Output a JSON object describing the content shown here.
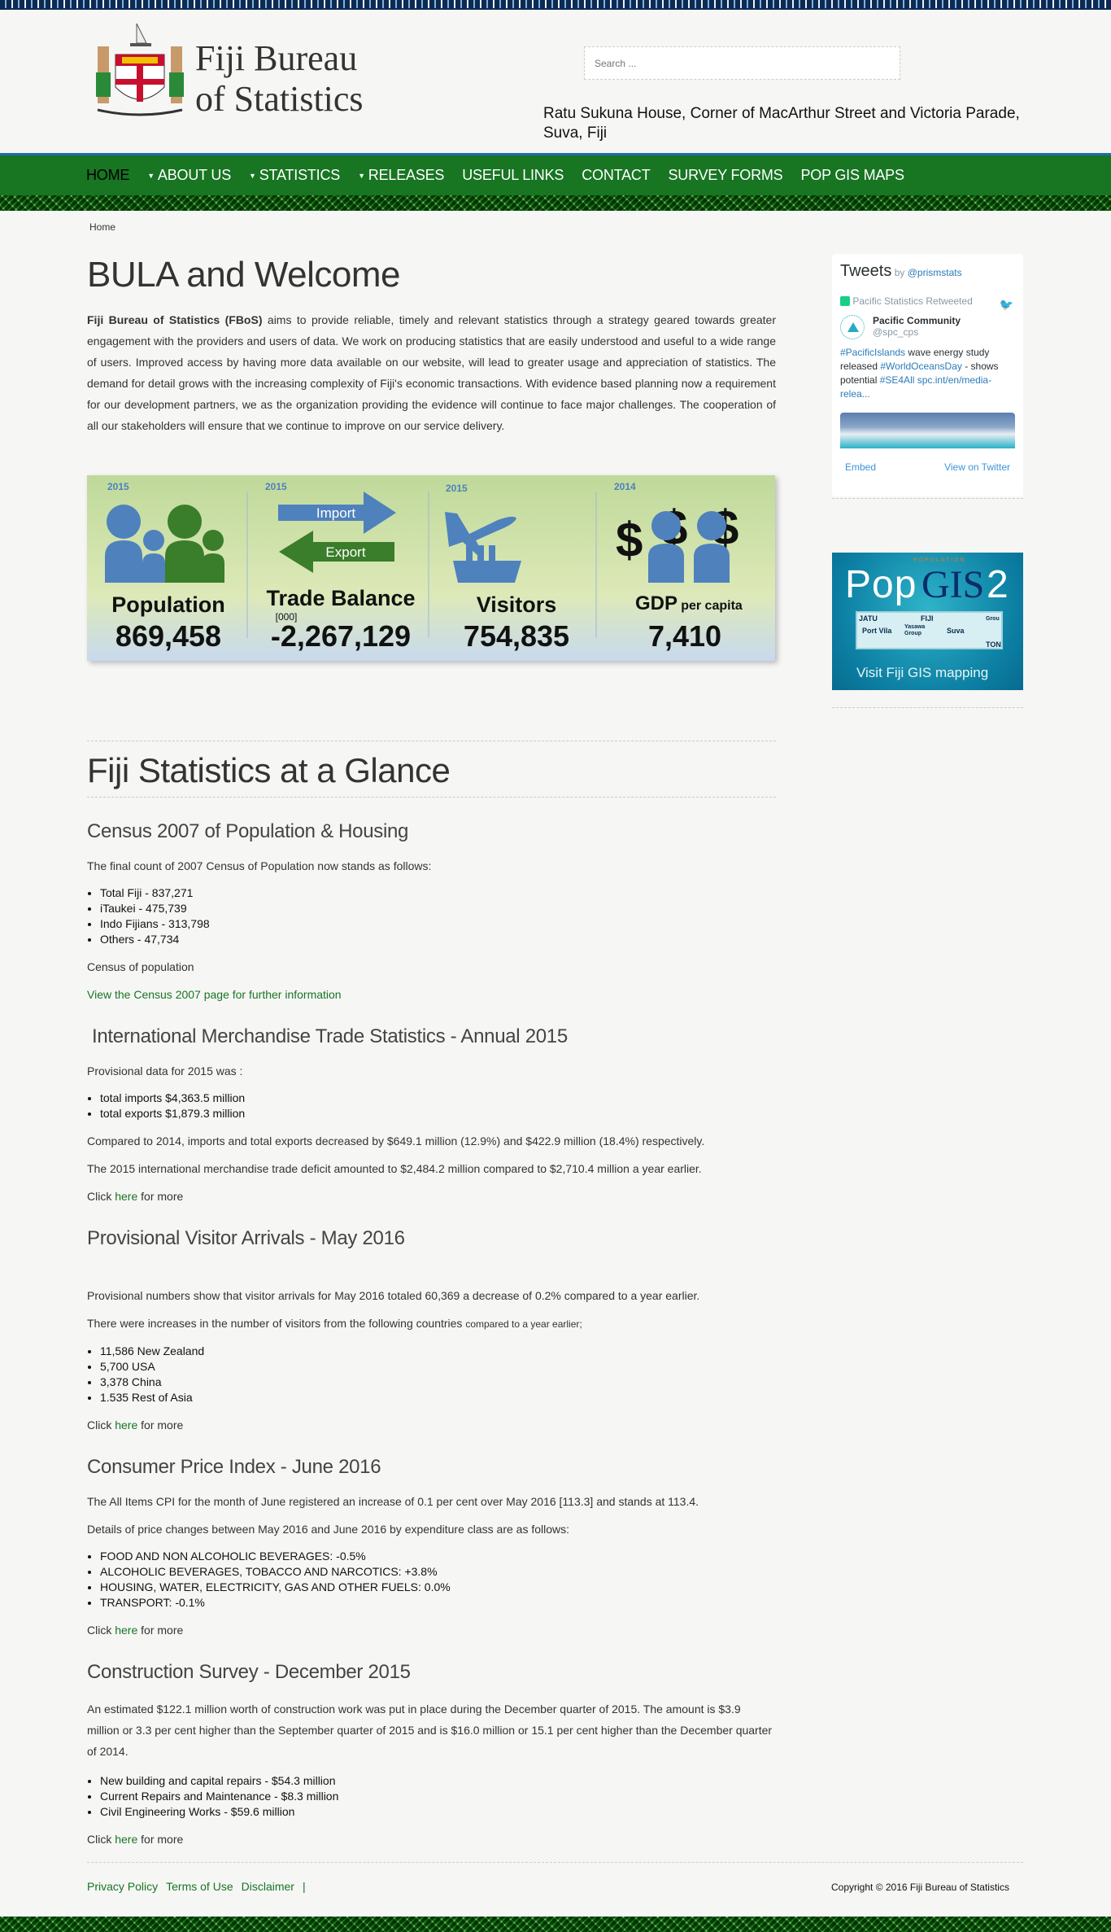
{
  "header": {
    "logo_line1": "Fiji Bureau",
    "logo_line2": "of Statistics",
    "logo_motto": "Rerevaka na Kalou ka doka na Tui",
    "search_placeholder": "Search ...",
    "address": "Ratu Sukuna House, Corner of MacArthur Street and Victoria Parade, Suva, Fiji"
  },
  "nav": {
    "items": [
      {
        "label": "HOME",
        "active": true,
        "dropdown": false
      },
      {
        "label": "ABOUT US",
        "dropdown": true
      },
      {
        "label": "STATISTICS",
        "dropdown": true
      },
      {
        "label": "RELEASES",
        "dropdown": true
      },
      {
        "label": "USEFUL LINKS",
        "dropdown": false
      },
      {
        "label": "CONTACT",
        "dropdown": false
      },
      {
        "label": "SURVEY FORMS",
        "dropdown": false
      },
      {
        "label": "POP GIS MAPS",
        "dropdown": false
      }
    ],
    "bg_color": "#187522"
  },
  "breadcrumb": "Home",
  "welcome": {
    "title": "BULA and Welcome",
    "lead_bold": "Fiji Bureau of Statistics (FBoS)",
    "text": " aims to provide reliable, timely and relevant statistics through a strategy geared towards greater engagement with the providers and users of data. We work on producing statistics that are easily understood and useful to a wide range of users. Improved access by having more data available on our website, will lead to greater usage and appreciation of statistics. The demand for detail grows with the increasing complexity of Fiji's economic transactions. With evidence based planning now a requirement for our development partners, we as the organization providing the evidence will continue to face major challenges. The cooperation of all our stakeholders will ensure that we continue to improve on our service delivery."
  },
  "infographic": {
    "population": {
      "year": "2015",
      "label": "Population",
      "value": "869,458"
    },
    "trade": {
      "year": "2015",
      "import": "Import",
      "export": "Export",
      "label": "Trade Balance",
      "unit": "[000]",
      "value": "-2,267,129"
    },
    "visitors": {
      "year": "2015",
      "label": "Visitors",
      "value": "754,835"
    },
    "gdp": {
      "year": "2014",
      "label": "GDP",
      "sub": "per capita",
      "value": "7,410"
    }
  },
  "glance": {
    "title": "Fiji Statistics at a Glance",
    "census": {
      "title": "Census 2007 of Population & Housing",
      "intro": "The final count of 2007 Census of Population now stands as follows:",
      "items": [
        "Total Fiji - 837,271",
        "iTaukei - 475,739",
        "Indo Fijians - 313,798",
        "Others - 47,734"
      ],
      "note": "Census of population",
      "link": "View the Census 2007 page for further information"
    },
    "trade": {
      "title": "International Merchandise Trade Statistics - Annual 2015",
      "intro": "Provisional data for 2015 was :",
      "items": [
        "total imports $4,363.5 million",
        "total exports $1,879.3 million"
      ],
      "p1": "Compared to 2014, imports and total exports decreased by $649.1 million (12.9%) and $422.9 million (18.4%) respectively.",
      "p2": "The 2015 international merchandise trade deficit amounted to $2,484.2 million compared to $2,710.4 million a year earlier."
    },
    "visitors": {
      "title": "Provisional Visitor Arrivals - May 2016",
      "p1": "Provisional numbers show that visitor arrivals for May 2016 totaled 60,369 a decrease of 0.2% compared to a year earlier.",
      "p2": "There were increases in the number of visitors from the following countries",
      "p2_small": "compared to a year earlier;",
      "items": [
        "11,586 New Zealand",
        "5,700 USA",
        "3,378 China",
        "1.535 Rest of Asia"
      ]
    },
    "cpi": {
      "title": "Consumer Price Index - June 2016",
      "p1": "The All Items CPI for the month of June registered an increase of 0.1 per cent over May 2016 [113.3] and stands at 113.4.",
      "p2": "Details of price changes between May 2016 and June 2016 by expenditure class are as follows:",
      "items": [
        "FOOD AND NON ALCOHOLIC BEVERAGES: -0.5%",
        "ALCOHOLIC BEVERAGES, TOBACCO AND NARCOTICS: +3.8%",
        "HOUSING, WATER, ELECTRICITY, GAS AND OTHER FUELS: 0.0%",
        "TRANSPORT: -0.1%"
      ]
    },
    "construction": {
      "title": "Construction Survey - December 2015",
      "p1": "An estimated $122.1 million worth of construction work was put in place during the December quarter of 2015. The amount is $3.9 million or 3.3 per cent higher than the September quarter of 2015 and is $16.0 million or 15.1 per cent higher than the December quarter of 2014.",
      "items": [
        "New building and capital repairs - $54.3 million",
        "Current Repairs and Maintenance - $8.3 million",
        "Civil Engineering Works - $59.6 million"
      ]
    },
    "click_pre": "Click ",
    "click_link": "here",
    "click_post": " for more"
  },
  "sidebar": {
    "tweets": {
      "title": "Tweets",
      "by": "by",
      "handle": "@prismstats",
      "retweeted": "Pacific Statistics Retweeted",
      "author": "Pacific Community",
      "author_handle": "@spc_cps",
      "tweet_parts": [
        "#PacificIslands",
        " wave energy study released ",
        "#WorldOceansDay",
        " - shows potential ",
        "#SE4All spc.int/en/media-relea..."
      ],
      "embed": "Embed",
      "view": "View on Twitter"
    },
    "popgis": {
      "title_pop": "Pop",
      "title_gis": "GIS",
      "title_num": "2",
      "arc": "POPULATION",
      "map_labels": [
        "JATU",
        "Port Vila",
        "FIJI",
        "Yasawa Group",
        "Suva",
        "Grou",
        "TON"
      ],
      "caption": "Visit Fiji GIS mapping"
    }
  },
  "footer": {
    "links": [
      "Privacy Policy",
      "Terms of Use",
      "Disclaimer",
      "|"
    ],
    "copyright": "Copyright © 2016 Fiji Bureau of Statistics"
  }
}
